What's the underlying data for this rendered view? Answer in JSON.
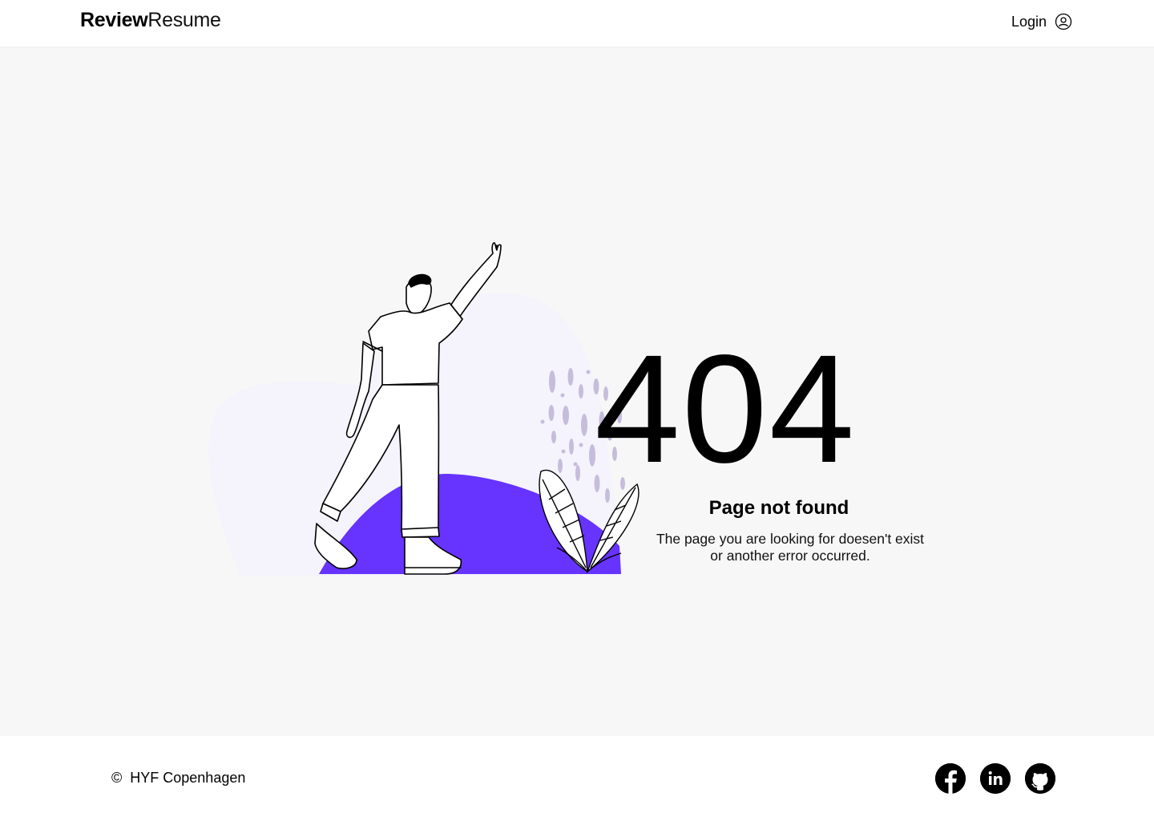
{
  "header": {
    "brand_bold": "Review",
    "brand_light": "Resume",
    "login_label": "Login",
    "login_icon": "user-circle-icon"
  },
  "main": {
    "error_code": "404",
    "title": "Page not found",
    "description_line1": "The page you are looking for doesen't exist",
    "description_line2": "or another error occurred.",
    "accent_color": "#6633ff",
    "blob_color": "#f5f3fb"
  },
  "footer": {
    "copyright_symbol": "©",
    "copyright_text": "HYF Copenhagen",
    "socials": [
      {
        "name": "facebook",
        "icon": "facebook-icon"
      },
      {
        "name": "linkedin",
        "icon": "linkedin-icon"
      },
      {
        "name": "github",
        "icon": "github-icon"
      }
    ]
  }
}
